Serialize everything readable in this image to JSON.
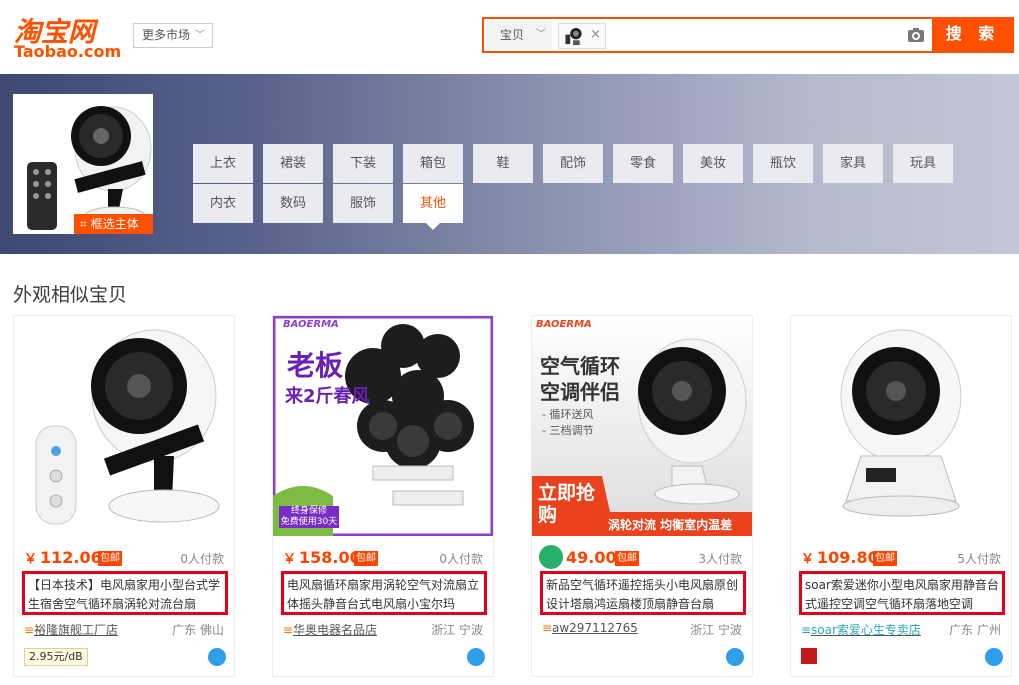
{
  "header": {
    "logo_cn": "淘宝网",
    "logo_en": "Taobao.com",
    "market_label": "更多市场",
    "search": {
      "type_label": "宝贝",
      "input_value": "",
      "button_label": "搜 索"
    }
  },
  "banner": {
    "crop_label": "框选主体",
    "categories": [
      {
        "label": "上衣"
      },
      {
        "label": "裙装"
      },
      {
        "label": "下装"
      },
      {
        "label": "箱包"
      },
      {
        "label": "鞋"
      },
      {
        "label": "配饰"
      },
      {
        "label": "零食"
      },
      {
        "label": "美妆"
      },
      {
        "label": "瓶饮"
      },
      {
        "label": "家具"
      },
      {
        "label": "玩具"
      },
      {
        "label": "内衣"
      },
      {
        "label": "数码"
      },
      {
        "label": "服饰"
      },
      {
        "label": "其他"
      }
    ],
    "active_category": "其他"
  },
  "section_title": "外观相似宝贝",
  "products": [
    {
      "price": "112.06",
      "yen": "￥",
      "mail": "包邮",
      "paid": "0人付款",
      "title": "【日本技术】电风扇家用小型台式学生宿舍空气循环扇涡轮对流台扇",
      "shop": "裕隆旗舰工厂店",
      "location": "广东 佛山",
      "extra_badge": "2.95元/dB"
    },
    {
      "price": "158.00",
      "yen": "￥",
      "mail": "包邮",
      "paid": "0人付款",
      "title": "电风扇循环扇家用涡轮空气对流扇立体摇头静音台式电风扇小宝尔玛",
      "shop": "华奥电器名品店",
      "location": "浙江 宁波",
      "image_text": {
        "brand": "BAOERMA",
        "line1": "老板",
        "line2": "来2斤春风",
        "warranty1": "终身保修",
        "warranty2": "免费使用30天"
      }
    },
    {
      "price": "49.00",
      "yen": "￥",
      "mail": "包邮",
      "paid": "3人付款",
      "title": "新品空气循环遥控摇头小电风扇原创设计塔扇鸿运扇楼顶扇静音台扇",
      "shop": "aw297112765",
      "location": "浙江 宁波",
      "image_text": {
        "brand": "BAOERMA",
        "line1": "空气循环",
        "line2": "空调伴侣",
        "bullet1": "- 循环送风",
        "bullet2": "- 三档调节",
        "promo": "立即抢购",
        "strip": "涡轮对流 均衡室内温差"
      }
    },
    {
      "price": "109.80",
      "yen": "￥",
      "mail": "包邮",
      "paid": "5人付款",
      "title": "soar索爱迷你小型电风扇家用静音台式遥控空调空气循环扇落地空调",
      "shop": "soar索爱心生专卖店",
      "location": "广东 广州"
    }
  ]
}
